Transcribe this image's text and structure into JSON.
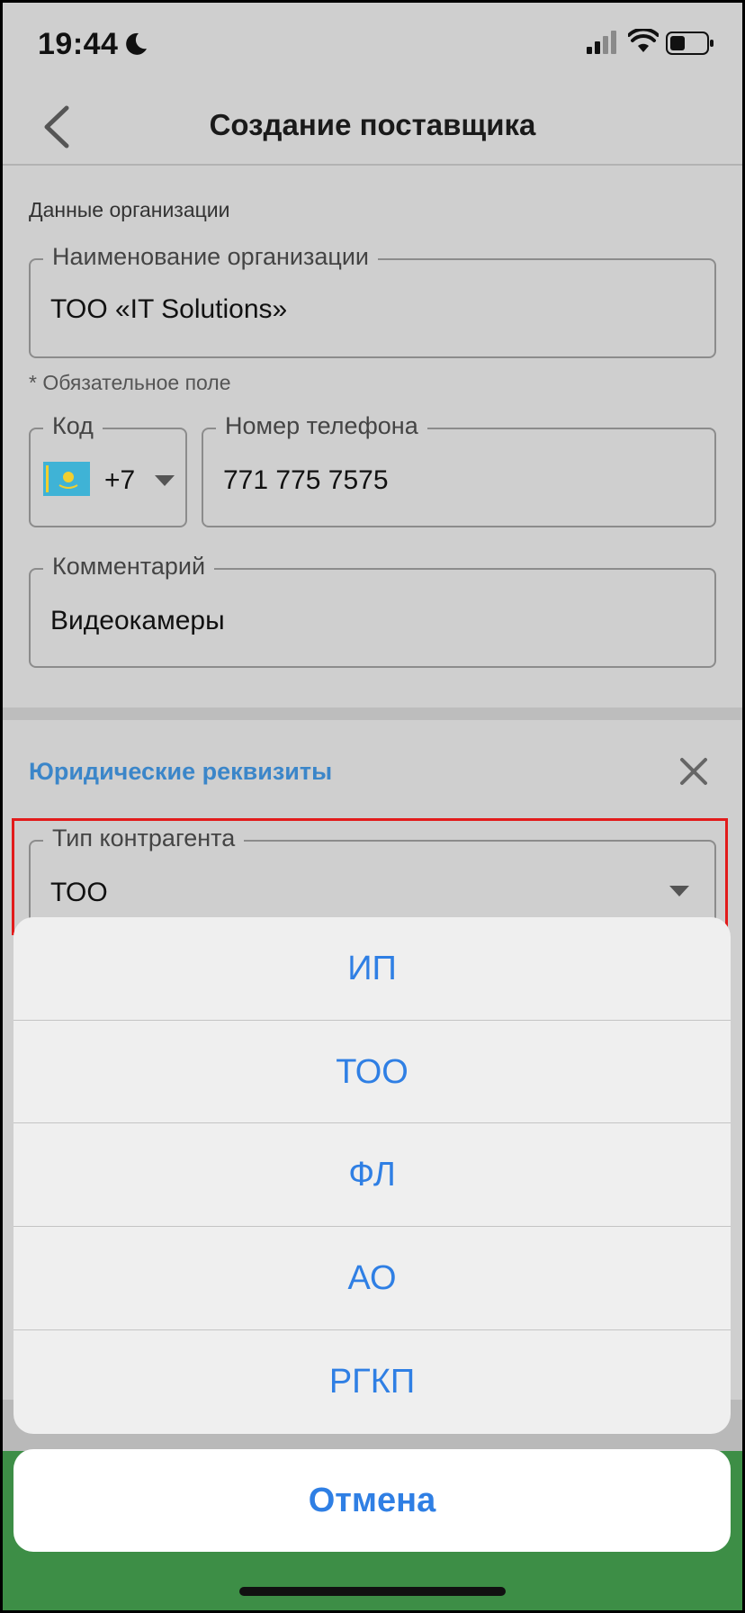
{
  "status_bar": {
    "time": "19:44"
  },
  "nav": {
    "title": "Создание поставщика"
  },
  "org": {
    "section_label": "Данные организации",
    "name_label": "Наименование организации",
    "name_value": "ТОО «IT Solutions»",
    "required_hint": "* Обязательное поле",
    "code_label": "Код",
    "code_value": "+7",
    "phone_label": "Номер телефона",
    "phone_value": "771 775 7575",
    "comment_label": "Комментарий",
    "comment_value": "Видеокамеры"
  },
  "legal": {
    "title": "Юридические реквизиты",
    "type_label": "Тип контрагента",
    "type_value": "ТОО"
  },
  "action_sheet": {
    "options": [
      "ИП",
      "ТОО",
      "ФЛ",
      "АО",
      "РГКП"
    ],
    "cancel_label": "Отмена"
  },
  "colors": {
    "accent": "#2f7fe4",
    "section_title": "#3b86c9",
    "highlight": "#e21b1b",
    "flag": "#3fb3d6"
  }
}
